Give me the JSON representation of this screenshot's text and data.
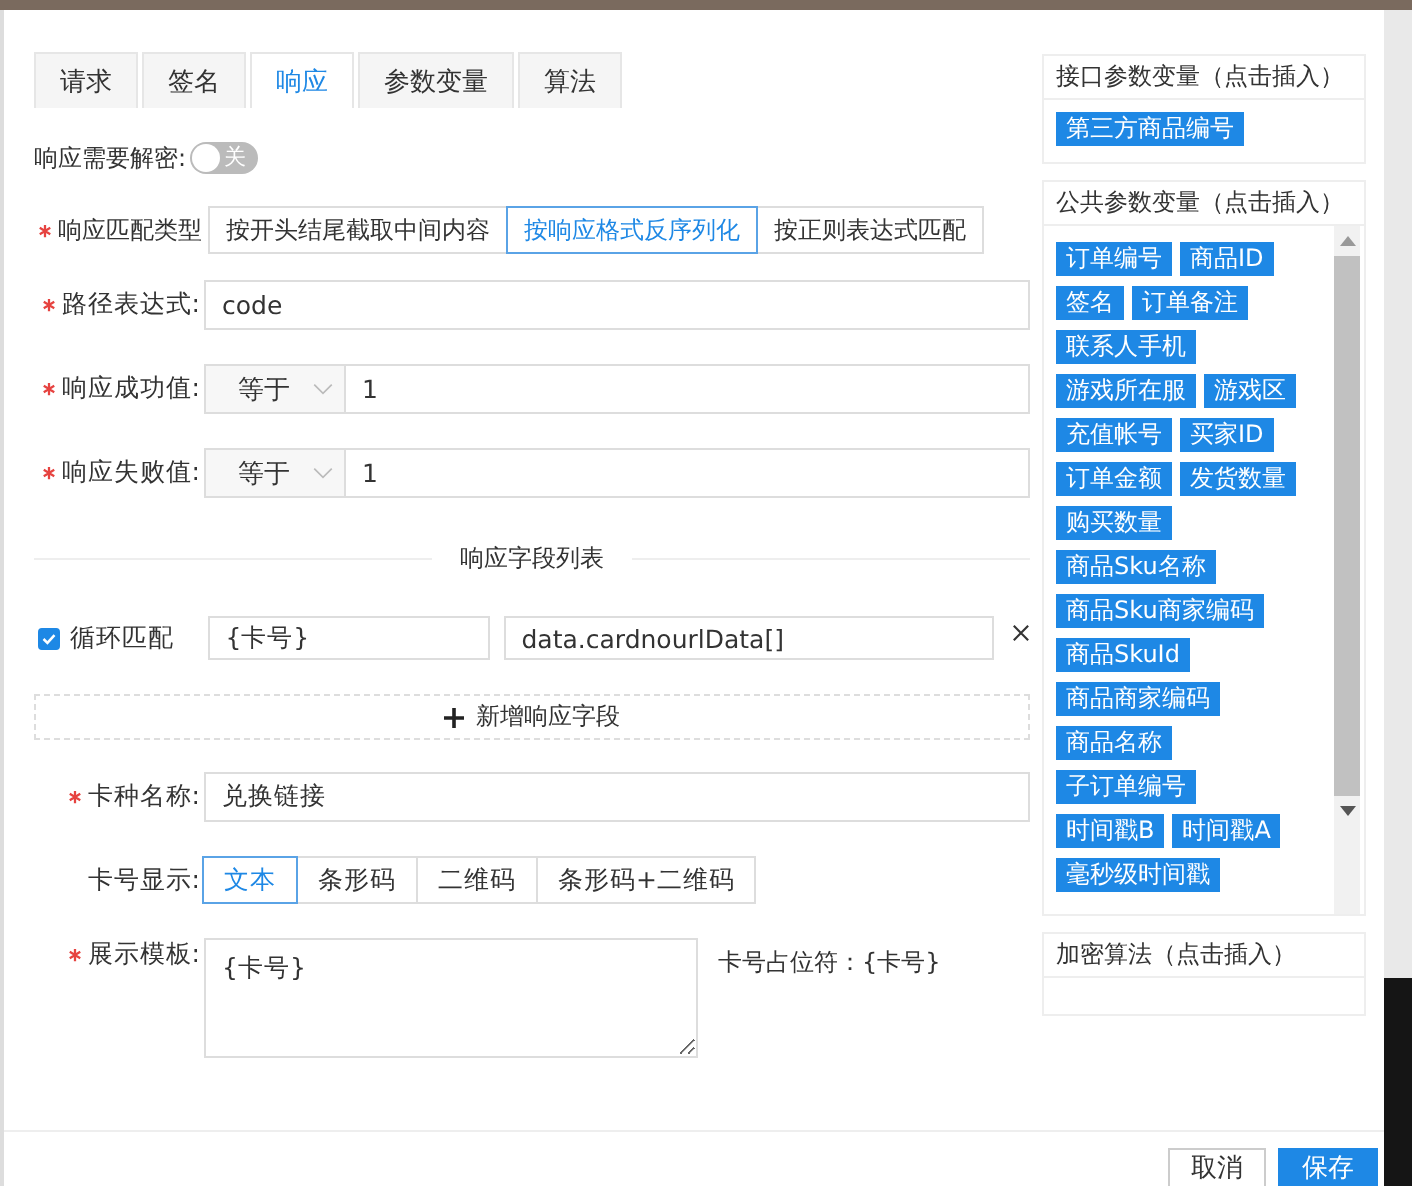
{
  "tabs": [
    {
      "label": "请求",
      "selected": false
    },
    {
      "label": "签名",
      "selected": false
    },
    {
      "label": "响应",
      "selected": true
    },
    {
      "label": "参数变量",
      "selected": false
    },
    {
      "label": "算法",
      "selected": false
    }
  ],
  "decrypt": {
    "label": "响应需要解密:",
    "on": false,
    "text": "关"
  },
  "match_type": {
    "label": "响应匹配类型",
    "required": true,
    "options": [
      {
        "label": "按开头结尾截取中间内容",
        "selected": false
      },
      {
        "label": "按响应格式反序列化",
        "selected": true
      },
      {
        "label": "按正则表达式匹配",
        "selected": false
      }
    ]
  },
  "path": {
    "label": "路径表达式:",
    "required": true,
    "value": "code"
  },
  "success": {
    "label": "响应成功值:",
    "required": true,
    "operator": "等于",
    "value": "1"
  },
  "failure": {
    "label": "响应失败值:",
    "required": true,
    "operator": "等于",
    "value": "1"
  },
  "fields": {
    "title": "响应字段列表",
    "rows": [
      {
        "loop_label": "循环匹配",
        "checked": true,
        "name": "{卡号}",
        "path": "data.cardnourlData[]"
      }
    ],
    "add_label": "新增响应字段"
  },
  "card_name": {
    "label": "卡种名称:",
    "required": true,
    "value": "兑换链接"
  },
  "card_display": {
    "label": "卡号显示:",
    "options": [
      {
        "label": "文本",
        "selected": true
      },
      {
        "label": "条形码",
        "selected": false
      },
      {
        "label": "二维码",
        "selected": false
      },
      {
        "label": "条形码+二维码",
        "selected": false
      }
    ]
  },
  "template": {
    "label": "展示模板:",
    "required": true,
    "value": "{卡号}",
    "hint": "卡号占位符：{卡号}"
  },
  "interface_vars": {
    "title": "接口参数变量（点击插入）",
    "chips": [
      "第三方商品编号"
    ]
  },
  "public_vars": {
    "title": "公共参数变量（点击插入）",
    "chips": [
      "订单编号",
      "商品ID",
      "签名",
      "订单备注",
      "联系人手机",
      "游戏所在服",
      "游戏区",
      "充值帐号",
      "买家ID",
      "订单金额",
      "发货数量",
      "购买数量",
      "商品Sku名称",
      "商品Sku商家编码",
      "商品SkuId",
      "商品商家编码",
      "商品名称",
      "子订单编号",
      "时间戳B",
      "时间戳A",
      "毫秒级时间戳"
    ]
  },
  "crypto": {
    "title": "加密算法（点击插入）"
  },
  "buttons": [
    {
      "label": "取消",
      "kind": "default"
    },
    {
      "label": "保存",
      "kind": "primary"
    }
  ]
}
